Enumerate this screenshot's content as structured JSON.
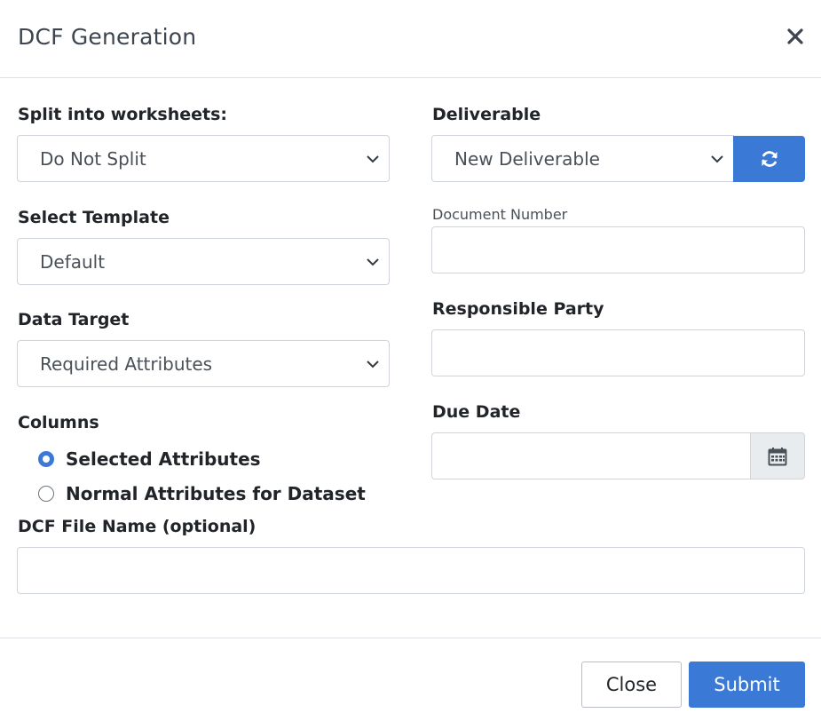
{
  "dialog": {
    "title": "DCF Generation",
    "close_icon": "close-x-icon"
  },
  "left": {
    "split_label": "Split into worksheets:",
    "split_value": "Do Not Split",
    "template_label": "Select Template",
    "template_value": "Default",
    "target_label": "Data Target",
    "target_value": "Required Attributes",
    "columns_label": "Columns",
    "columns_options": [
      {
        "label": "Selected Attributes",
        "checked": true
      },
      {
        "label": "Normal Attributes for Dataset",
        "checked": false
      }
    ]
  },
  "right": {
    "deliverable_label": "Deliverable",
    "deliverable_value": "New Deliverable",
    "refresh_icon": "refresh-icon",
    "doc_number_label": "Document Number",
    "doc_number_value": "",
    "responsible_label": "Responsible Party",
    "responsible_value": "",
    "due_date_label": "Due Date",
    "due_date_value": "",
    "calendar_icon": "calendar-icon"
  },
  "file_name": {
    "label": "DCF File Name (optional)",
    "value": ""
  },
  "footer": {
    "close_label": "Close",
    "submit_label": "Submit"
  },
  "colors": {
    "primary": "#3a7ad6",
    "border": "#ced4da",
    "addon_bg": "#e9ecef"
  }
}
